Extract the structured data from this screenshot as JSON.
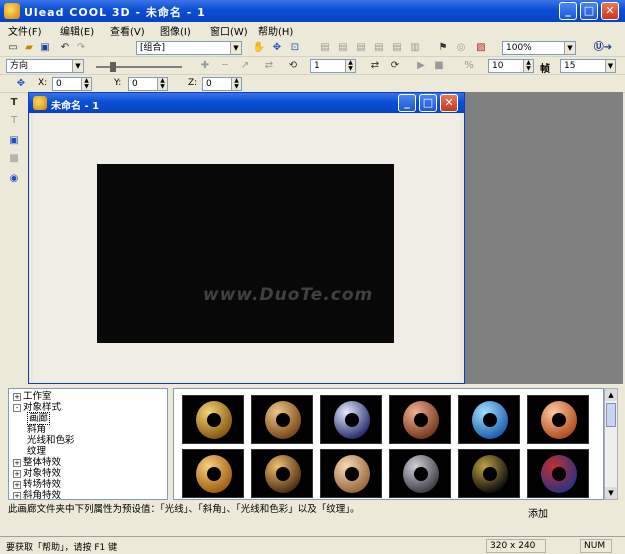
{
  "app": {
    "title": "Ulead COOL 3D - 未命名 - 1"
  },
  "menu": [
    "文件(F)",
    "编辑(E)",
    "查看(V)",
    "图像(I)",
    "窗口(W)",
    "帮助(H)"
  ],
  "toolbar1": {
    "combo_value": "[组合]",
    "zoom_value": "100%"
  },
  "toolbar2": {
    "direction_value": "方向",
    "frame_value": "1",
    "value_a": "10",
    "fps_label": "帧",
    "value_b": "15"
  },
  "toolbar3": {
    "x_label": "X:",
    "x_value": "0",
    "y_label": "Y:",
    "y_value": "0",
    "z_label": "Z:",
    "z_value": "0"
  },
  "document": {
    "title": "未命名 - 1"
  },
  "watermark": "www.DuoTe.com",
  "tree": [
    {
      "label": "工作室",
      "toggle": "+"
    },
    {
      "label": "对象样式",
      "toggle": "-"
    },
    {
      "label": "画廊",
      "selected": true
    },
    {
      "label": "斜角"
    },
    {
      "label": "光线和色彩"
    },
    {
      "label": "纹理"
    },
    {
      "label": "整体特效",
      "toggle": "+"
    },
    {
      "label": "对象特效",
      "toggle": "+"
    },
    {
      "label": "转场特效",
      "toggle": "+"
    },
    {
      "label": "斜角特效",
      "toggle": "+"
    }
  ],
  "gallery_items": [
    {
      "name": "gold-ring",
      "colors": [
        "#f2d27a",
        "#8a5a10"
      ]
    },
    {
      "name": "bronze-ring",
      "colors": [
        "#f0c888",
        "#7a4a18"
      ]
    },
    {
      "name": "chrome-ring",
      "colors": [
        "#e8eaff",
        "#2a3070"
      ]
    },
    {
      "name": "copper-ring",
      "colors": [
        "#f0b090",
        "#7a3a20"
      ]
    },
    {
      "name": "blue-ring",
      "colors": [
        "#a0e0ff",
        "#2060b0"
      ]
    },
    {
      "name": "orange-ring",
      "colors": [
        "#ffc8a0",
        "#b05020"
      ]
    },
    {
      "name": "amber-ring",
      "colors": [
        "#f8d080",
        "#a06010"
      ]
    },
    {
      "name": "leopard-ring",
      "colors": [
        "#f0c070",
        "#503010"
      ]
    },
    {
      "name": "dotted-ring",
      "colors": [
        "#f8d8b0",
        "#9a6a40"
      ]
    },
    {
      "name": "steel-ring",
      "colors": [
        "#d0d0d8",
        "#404048"
      ]
    },
    {
      "name": "starry-ring",
      "colors": [
        "#c0a040",
        "#101010"
      ]
    },
    {
      "name": "patch-ring",
      "colors": [
        "#c03030",
        "#303080"
      ]
    }
  ],
  "description": "此画廊文件夹中下列属性为预设值：「光线」、「斜角」、「光线和色彩」以及「纹理」。",
  "add_label": "添加",
  "status": {
    "help_text": "要获取「帮助」，请按 F1 键",
    "size": "320 x 240",
    "num": "NUM"
  }
}
